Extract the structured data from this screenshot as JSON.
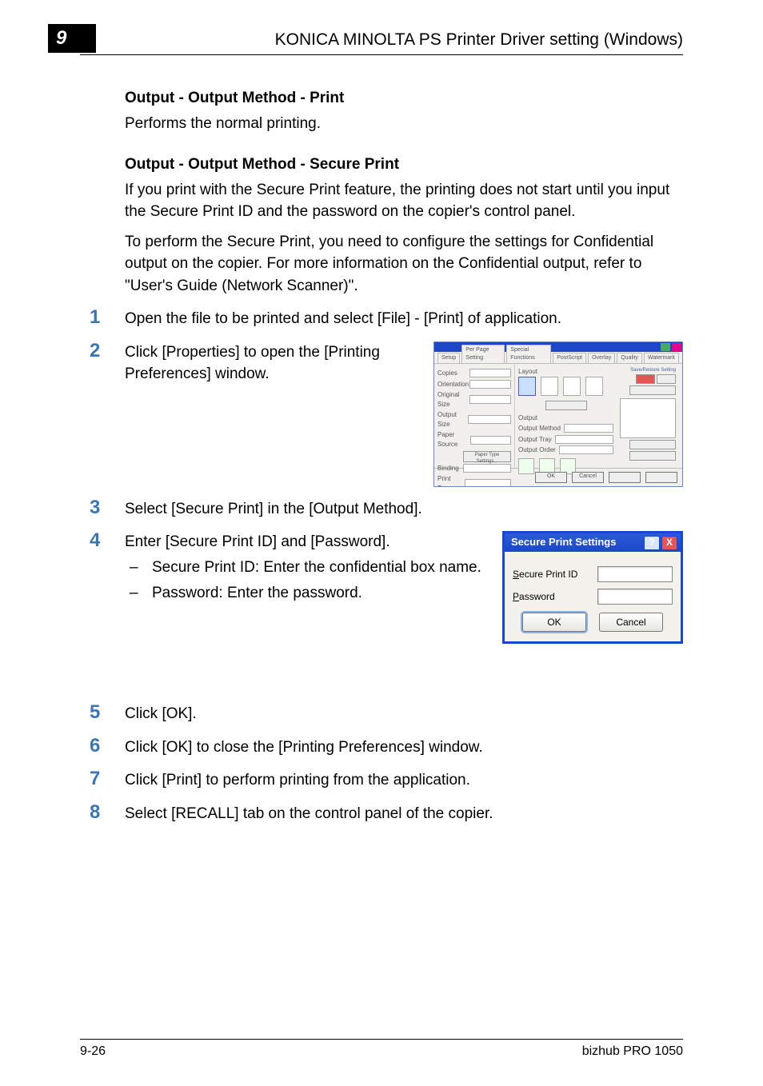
{
  "header": {
    "chapter_number": "9",
    "title": "KONICA MINOLTA PS Printer Driver setting (Windows)"
  },
  "section1": {
    "title": "Output - Output Method - Print",
    "para": "Performs the normal printing."
  },
  "section2": {
    "title": "Output - Output Method - Secure Print",
    "para1": "If you print with the Secure Print feature, the printing does not start until you input the Secure Print ID and the password on the copier's control panel.",
    "para2": "To perform the Secure Print, you need to configure the settings for Confidential output on the copier. For more information on the Confidential output, refer to \"User's Guide (Network Scanner)\"."
  },
  "steps": {
    "s1": {
      "num": "1",
      "text": "Open the file to be printed and select [File] - [Print] of application."
    },
    "s2": {
      "num": "2",
      "text": "Click [Properties] to open the [Printing Preferences] window."
    },
    "s3": {
      "num": "3",
      "text": "Select [Secure Print] in the [Output Method]."
    },
    "s4": {
      "num": "4",
      "text": "Enter [Secure Print ID] and [Password].",
      "sub1": "Secure Print ID: Enter the confidential box name.",
      "sub2": "Password: Enter the password."
    },
    "s5": {
      "num": "5",
      "text": "Click [OK]."
    },
    "s6": {
      "num": "6",
      "text": "Click [OK] to close the [Printing Preferences] window."
    },
    "s7": {
      "num": "7",
      "text": "Click [Print] to perform printing from the application."
    },
    "s8": {
      "num": "8",
      "text": "Select [RECALL] tab on the control panel of the copier."
    }
  },
  "dialog": {
    "title": "Secure Print Settings",
    "label_id_prefix": "S",
    "label_id_rest": "ecure Print ID",
    "label_pw_prefix": "P",
    "label_pw_rest": "assword",
    "ok": "OK",
    "cancel": "Cancel",
    "help": "?",
    "close": "X"
  },
  "printprefs": {
    "ok": "OK",
    "cancel": "Cancel"
  },
  "footer": {
    "page": "9-26",
    "product": "bizhub PRO 1050"
  }
}
